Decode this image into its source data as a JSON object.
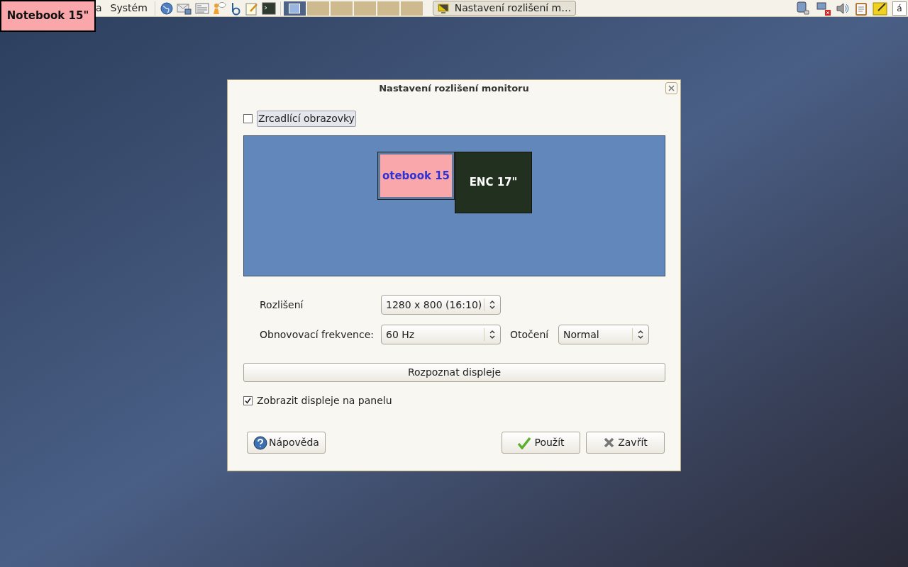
{
  "panel": {
    "menus": [
      "a",
      "Systém"
    ],
    "workspaces": [
      {
        "selected": true
      },
      {
        "selected": false
      },
      {
        "selected": false
      },
      {
        "selected": false
      },
      {
        "selected": false
      },
      {
        "selected": false
      }
    ],
    "task": {
      "label": "Nastavení rozlišení m…",
      "selected": true
    },
    "keyboard_indicator": "á"
  },
  "display_label": "Notebook 15\"",
  "dialog": {
    "title": "Nastavení rozlišení monitoru",
    "mirror": {
      "label": "Zrcadlící obrazovky",
      "checked": false
    },
    "monitors": [
      {
        "label": "otebook 15",
        "selected": true
      },
      {
        "label": "ENC 17\"",
        "selected": false
      }
    ],
    "resolution": {
      "label": "Rozlišení",
      "value": "1280 x 800 (16:10)"
    },
    "refresh": {
      "label": "Obnovovací frekvence:",
      "value": "60 Hz"
    },
    "rotation": {
      "label": "Otočení",
      "value": "Normal"
    },
    "detect_button": "Rozpoznat displeje",
    "show_in_panel": {
      "label": "Zobrazit displeje na panelu",
      "checked": true
    },
    "help_button": "Nápověda",
    "apply_button": "Použít",
    "close_button": "Zavřít"
  }
}
